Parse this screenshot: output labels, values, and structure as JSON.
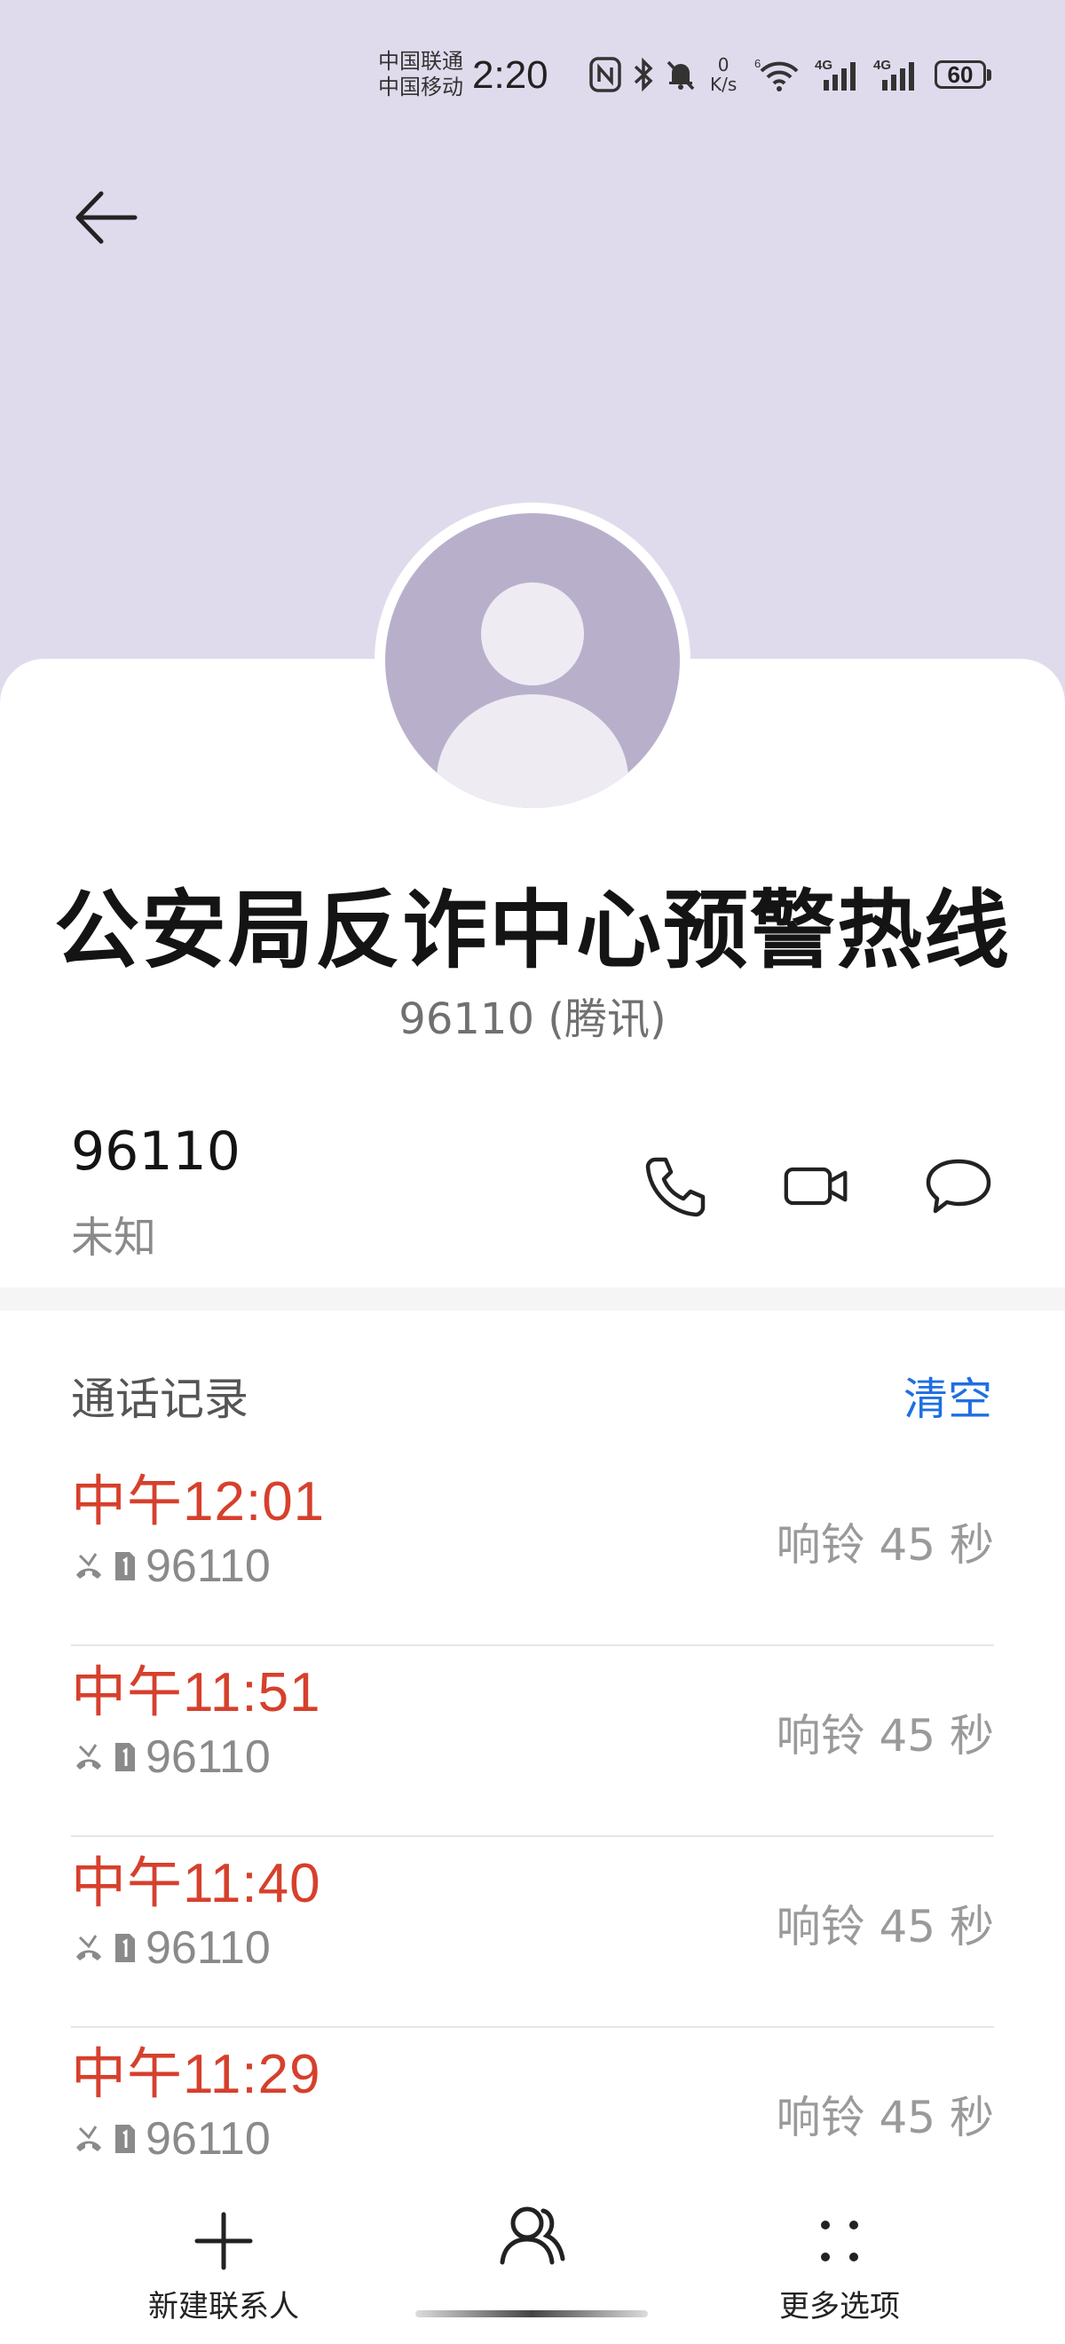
{
  "status_bar": {
    "carrier1": "中国联通",
    "carrier2": "中国移动",
    "time": "2:20",
    "net_speed_value": "0",
    "net_speed_unit": "K/s",
    "wifi_label": "6",
    "signal1_label": "4G",
    "signal2_label": "4G",
    "battery": "60"
  },
  "contact": {
    "name": "公安局反诈中心预警热线",
    "subtitle": "96110 (腾讯)",
    "number": "96110",
    "number_type": "未知"
  },
  "call_log": {
    "title": "通话记录",
    "clear_label": "清空",
    "records": [
      {
        "time": "中午12:01",
        "number": "96110",
        "duration": "响铃 45 秒"
      },
      {
        "time": "中午11:51",
        "number": "96110",
        "duration": "响铃 45 秒"
      },
      {
        "time": "中午11:40",
        "number": "96110",
        "duration": "响铃 45 秒"
      },
      {
        "time": "中午11:29",
        "number": "96110",
        "duration": "响铃 45 秒"
      }
    ]
  },
  "bottom_nav": {
    "new_contact": "新建联系人",
    "more_options": "更多选项"
  },
  "colors": {
    "header_bg": "#e0dbec",
    "avatar_bg": "#b8b0cb",
    "missed_red": "#d6402c",
    "accent_blue": "#1f6fe0"
  }
}
